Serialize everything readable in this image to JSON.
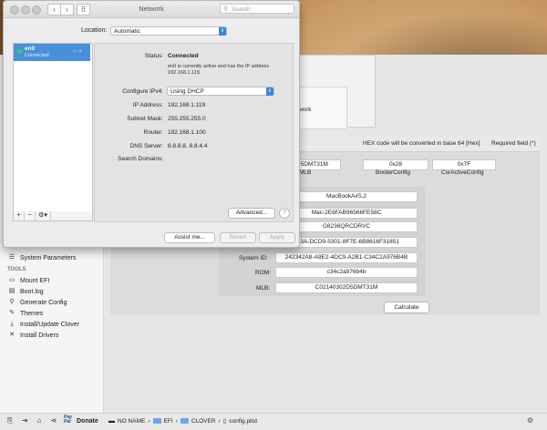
{
  "network": {
    "title": "Network",
    "search_placeholder": "Search",
    "location_label": "Location:",
    "location_value": "Automatic",
    "service": {
      "name": "en0",
      "status": "Connected"
    },
    "status_label": "Status:",
    "status_value": "Connected",
    "status_desc_1": "en0 is currently active and has the IP address",
    "status_desc_2": "192.168.1.119.",
    "configure_label": "Configure IPv4:",
    "configure_value": "Using DHCP",
    "ip_label": "IP Address:",
    "ip_value": "192.168.1.119",
    "subnet_label": "Subnet Mask:",
    "subnet_value": "255.255.255.0",
    "router_label": "Router:",
    "router_value": "192.168.1.100",
    "dns_label": "DNS Server:",
    "dns_value": "8.8.8.8, 8.8.4.4",
    "domains_label": "Search Domains:",
    "advanced_label": "Advanced...",
    "help_label": "?",
    "assist_label": "Assist me...",
    "revert_label": "Revert",
    "apply_label": "Apply",
    "tools": [
      "+",
      "−",
      "⚙▾"
    ]
  },
  "mid_window_text": "twork",
  "clover": {
    "header_hint": "HEX code will be converted in base 64 [Hex]",
    "required": "Required field (*)",
    "top_fields": [
      {
        "value": "802D5DMT31M",
        "label": "MLB"
      },
      {
        "value": "0x28",
        "label": "BooterConfig"
      },
      {
        "value": "0x7F",
        "label": "CsrActiveConfig"
      }
    ],
    "fields": {
      "product": "MacBookAir5,2",
      "board": "Mac-2E6FAB96566FE58C",
      "serial": "G8236QRCDRVC",
      "uuid_partial": "353A-DCD9-5301-8F7E-6B8616F31851",
      "system_id_label": "System ID:",
      "system_id": "242342A8-A9E2-4DC9-A2B1-C34C2A976B4B",
      "rom_label": "ROM:",
      "rom": "c34c2a976b4b",
      "mlb_label": "MLB:",
      "mlb": "C02140302D5DMT31M"
    },
    "calculate_label": "Calculate",
    "sidebar": {
      "system_parameters": "System Parameters",
      "tools_heading": "TOOLS",
      "items": [
        "Mount EFI",
        "Boot.log",
        "Generate Config",
        "Themes",
        "Install/Update Clover",
        "Install Drivers"
      ]
    },
    "path": [
      "NO NAME",
      "EFI",
      "CLOVER",
      "config.plist"
    ],
    "donate": "Donate",
    "paypal": "Pay Pal"
  }
}
